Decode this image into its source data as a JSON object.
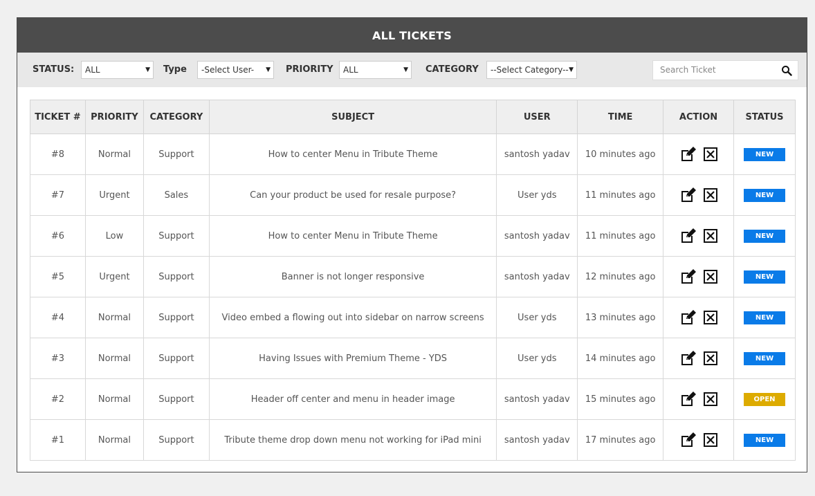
{
  "header": {
    "title": "ALL TICKETS"
  },
  "filters": {
    "status_label": "STATUS:",
    "status_value": "ALL",
    "type_label": "Type",
    "type_value": "-Select User-",
    "priority_label": "PRIORITY",
    "priority_value": "ALL",
    "category_label": "CATEGORY",
    "category_value": "--Select Category--",
    "search_placeholder": "Search Ticket"
  },
  "table": {
    "columns": [
      "TICKET #",
      "PRIORITY",
      "CATEGORY",
      "SUBJECT",
      "USER",
      "TIME",
      "ACTION",
      "STATUS"
    ],
    "rows": [
      {
        "id": "#8",
        "priority": "Normal",
        "category": "Support",
        "subject": "How to center Menu in Tribute Theme",
        "user": "santosh yadav",
        "time": "10 minutes ago",
        "status": "NEW"
      },
      {
        "id": "#7",
        "priority": "Urgent",
        "category": "Sales",
        "subject": "Can your product be used for resale purpose?",
        "user": "User yds",
        "time": "11 minutes ago",
        "status": "NEW"
      },
      {
        "id": "#6",
        "priority": "Low",
        "category": "Support",
        "subject": "How to center Menu in Tribute Theme",
        "user": "santosh yadav",
        "time": "11 minutes ago",
        "status": "NEW"
      },
      {
        "id": "#5",
        "priority": "Urgent",
        "category": "Support",
        "subject": "Banner is not longer responsive",
        "user": "santosh yadav",
        "time": "12 minutes ago",
        "status": "NEW"
      },
      {
        "id": "#4",
        "priority": "Normal",
        "category": "Support",
        "subject": "Video embed a flowing out into sidebar on narrow screens",
        "user": "User yds",
        "time": "13 minutes ago",
        "status": "NEW"
      },
      {
        "id": "#3",
        "priority": "Normal",
        "category": "Support",
        "subject": "Having Issues with Premium Theme - YDS",
        "user": "User yds",
        "time": "14 minutes ago",
        "status": "NEW"
      },
      {
        "id": "#2",
        "priority": "Normal",
        "category": "Support",
        "subject": "Header off center and menu in header image",
        "user": "santosh yadav",
        "time": "15 minutes ago",
        "status": "OPEN"
      },
      {
        "id": "#1",
        "priority": "Normal",
        "category": "Support",
        "subject": "Tribute theme drop down menu not working for iPad mini",
        "user": "santosh yadav",
        "time": "17 minutes ago",
        "status": "NEW"
      }
    ]
  },
  "colors": {
    "header_bg": "#4c4c4c",
    "filter_bg": "#e8e8e8",
    "status_new": "#0a7be8",
    "status_open": "#ddab00"
  },
  "icons": {
    "edit": "edit-icon",
    "delete": "delete-icon",
    "search": "search-icon",
    "dropdown": "chevron-down-icon"
  }
}
